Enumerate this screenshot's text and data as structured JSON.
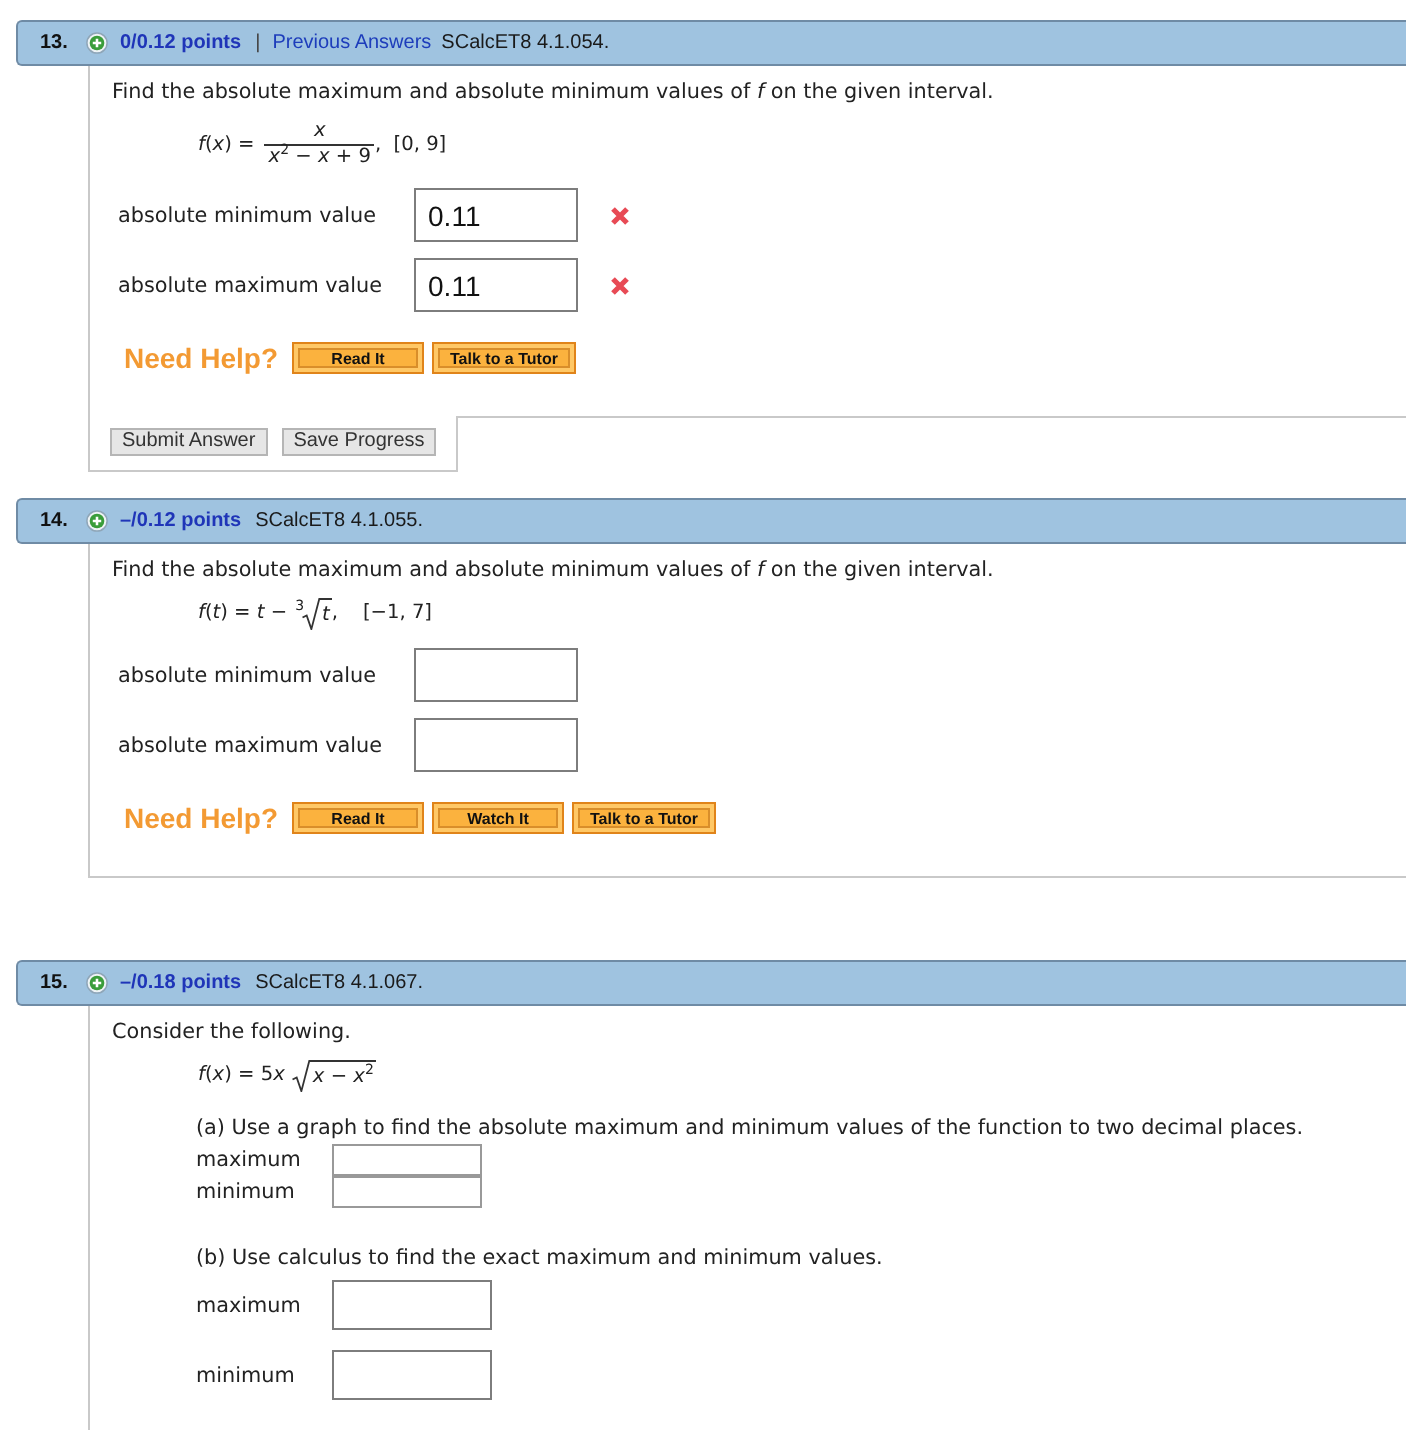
{
  "questions": [
    {
      "number": "13.",
      "points": "0/0.12 points",
      "separator": "|",
      "link": "Previous Answers",
      "code": "SCalcET8 4.1.054.",
      "prompt": "Find the absolute maximum and absolute minimum values of *f* on the given interval.",
      "formula": {
        "kind": "fraction",
        "lhs": [
          "*f*(*x*) ="
        ],
        "numerator": "*x*",
        "denominator": "*x*$^{2}$ − *x* + 9",
        "rest": ",  [0, 9]"
      },
      "parts": [
        {
          "kind": "spaced",
          "answers": [
            {
              "label": "absolute minimum value",
              "value": "0.11",
              "correct": false
            },
            {
              "label": "absolute maximum value",
              "value": "0.11",
              "correct": false
            }
          ]
        }
      ],
      "help": {
        "title": "Need Help?",
        "buttons": [
          "Read It",
          "Talk to a Tutor"
        ]
      },
      "actions": [
        "Submit Answer",
        "Save Progress"
      ]
    },
    {
      "number": "14.",
      "points": "–/0.12 points",
      "code": "SCalcET8 4.1.055.",
      "prompt": "Find the absolute maximum and absolute minimum values of *f* on the given interval.",
      "formula": {
        "kind": "root",
        "lhs": [
          "*f*(*t*) = *t* −"
        ],
        "index": "3",
        "radicand": "*t*",
        "rest": ",    [−1, 7]"
      },
      "parts": [
        {
          "kind": "spaced",
          "answers": [
            {
              "label": "absolute minimum value"
            },
            {
              "label": "absolute maximum value"
            }
          ]
        }
      ],
      "help": {
        "title": "Need Help?",
        "buttons": [
          "Read It",
          "Watch It",
          "Talk to a Tutor"
        ]
      }
    },
    {
      "number": "15.",
      "points": "–/0.18 points",
      "code": "SCalcET8 4.1.067.",
      "prompt": "Consider the following.",
      "formula": {
        "kind": "root",
        "lhs": [
          "*f*(*x*) = 5",
          "*x*"
        ],
        "radicand": "*x* − *x*$^{2}$"
      },
      "parts": [
        {
          "kind": "compact",
          "prompt": "(a) Use a graph to find the absolute maximum and minimum values of the function to two decimal places.",
          "answers": [
            {
              "label": "maximum"
            },
            {
              "label": "minimum"
            }
          ]
        },
        {
          "kind": "spaced",
          "prompt": "(b) Use calculus to find the exact maximum and minimum values.",
          "answers": [
            {
              "label": "maximum"
            },
            {
              "label": "minimum"
            }
          ]
        }
      ]
    }
  ]
}
